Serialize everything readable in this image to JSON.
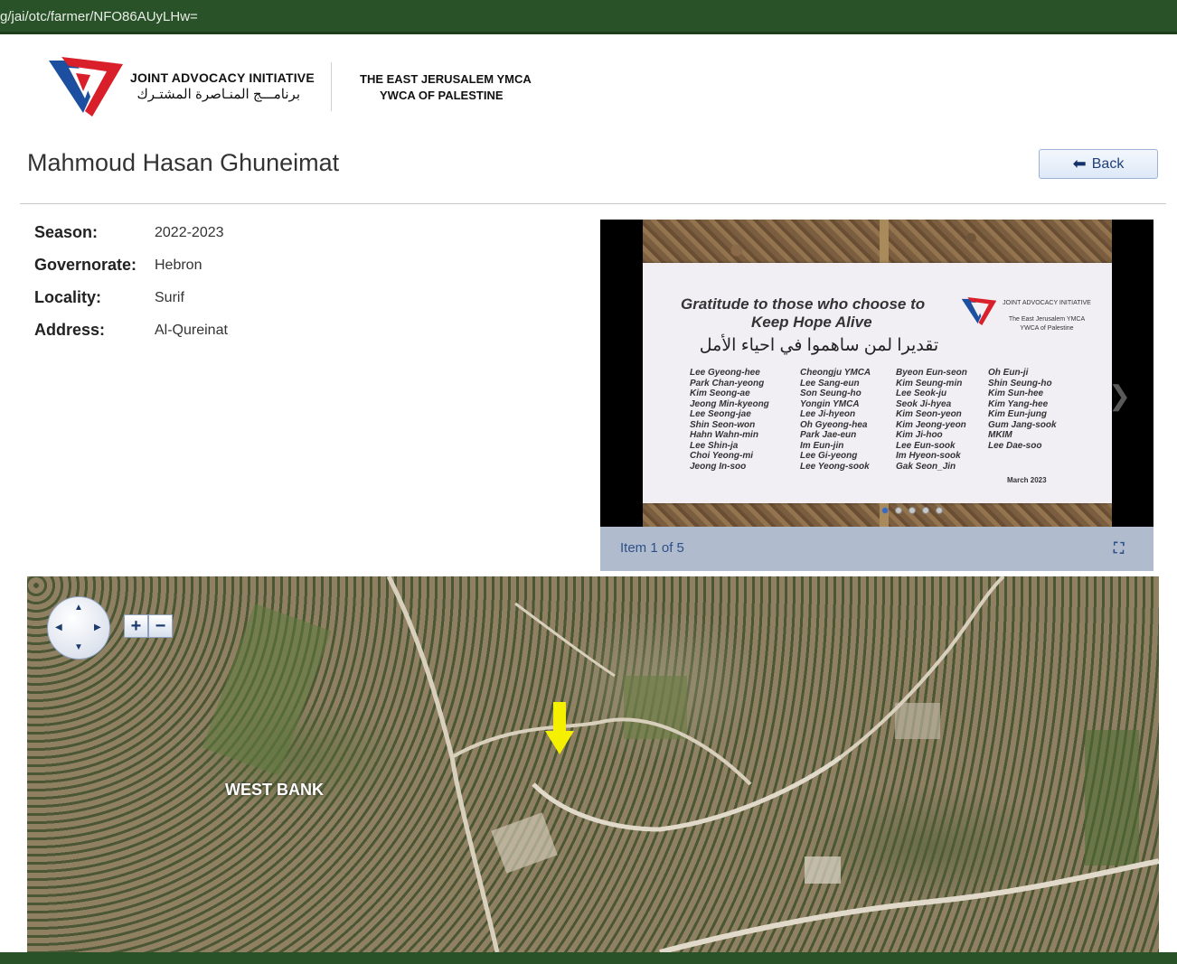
{
  "browser": {
    "url": "g/jai/otc/farmer/NFO86AUyLHw="
  },
  "header": {
    "org_name_en": "JOINT ADVOCACY INITIATIVE",
    "org_name_ar": "برنامـــج المنـاصرة المشتـرك",
    "partner_line1": "THE EAST JERUSALEM YMCA",
    "partner_line2": "YWCA OF PALESTINE"
  },
  "page": {
    "title": "Mahmoud Hasan Ghuneimat",
    "back_label": "Back"
  },
  "info": {
    "season_label": "Season:",
    "season_value": "2022-2023",
    "governorate_label": "Governorate:",
    "governorate_value": "Hebron",
    "locality_label": "Locality:",
    "locality_value": "Surif",
    "address_label": "Address:",
    "address_value": "Al-Qureinat"
  },
  "carousel": {
    "caption": "Item 1 of 5",
    "total_items": 5,
    "active_index": 0,
    "sign": {
      "title_line1": "Gratitude to those who choose to",
      "title_line2": "Keep Hope Alive",
      "title_ar": "تقديرا لمن ساهموا في احياء الأمل",
      "org_line1": "JOINT ADVOCACY INITIATIVE",
      "org_line2": "The East Jerusalem YMCA",
      "org_line3": "YWCA of Palestine",
      "date": "March 2023",
      "col1": [
        "Lee Gyeong-hee",
        "Park Chan-yeong",
        "Kim Seong-ae",
        "Jeong Min-kyeong",
        "Lee Seong-jae",
        "Shin Seon-won",
        "Hahn Wahn-min",
        "Lee Shin-ja",
        "Choi Yeong-mi",
        "Jeong In-soo"
      ],
      "col2": [
        "Cheongju YMCA",
        "Lee Sang-eun",
        "Son Seung-ho",
        "Yongin YMCA",
        "Lee Ji-hyeon",
        "Oh Gyeong-hea",
        "Park Jae-eun",
        "Im Eun-jin",
        "Lee Gi-yeong",
        "Lee Yeong-sook"
      ],
      "col3": [
        "Byeon Eun-seon",
        "Kim Seung-min",
        "Lee Seok-ju",
        "Seok Ji-hyea",
        "Kim Seon-yeon",
        "Kim Jeong-yeon",
        "Kim Ji-hoo",
        "Lee Eun-sook",
        "Im Hyeon-sook",
        "Gak Seon_Jin"
      ],
      "col4": [
        "Oh Eun-ji",
        "Shin Seung-ho",
        "Kim Sun-hee",
        "Kim Yang-hee",
        "Kim Eun-jung",
        "Gum Jang-sook",
        "MKIM",
        "Lee Dae-soo"
      ]
    }
  },
  "map": {
    "region_label": "WEST BANK",
    "zoom_in": "+",
    "zoom_out": "−",
    "marker_color": "#f5f000"
  },
  "colors": {
    "browser_bar": "#2a5228",
    "link_blue": "#2e4f88",
    "logo_red": "#d91f2a",
    "logo_blue": "#1d4fa0"
  }
}
